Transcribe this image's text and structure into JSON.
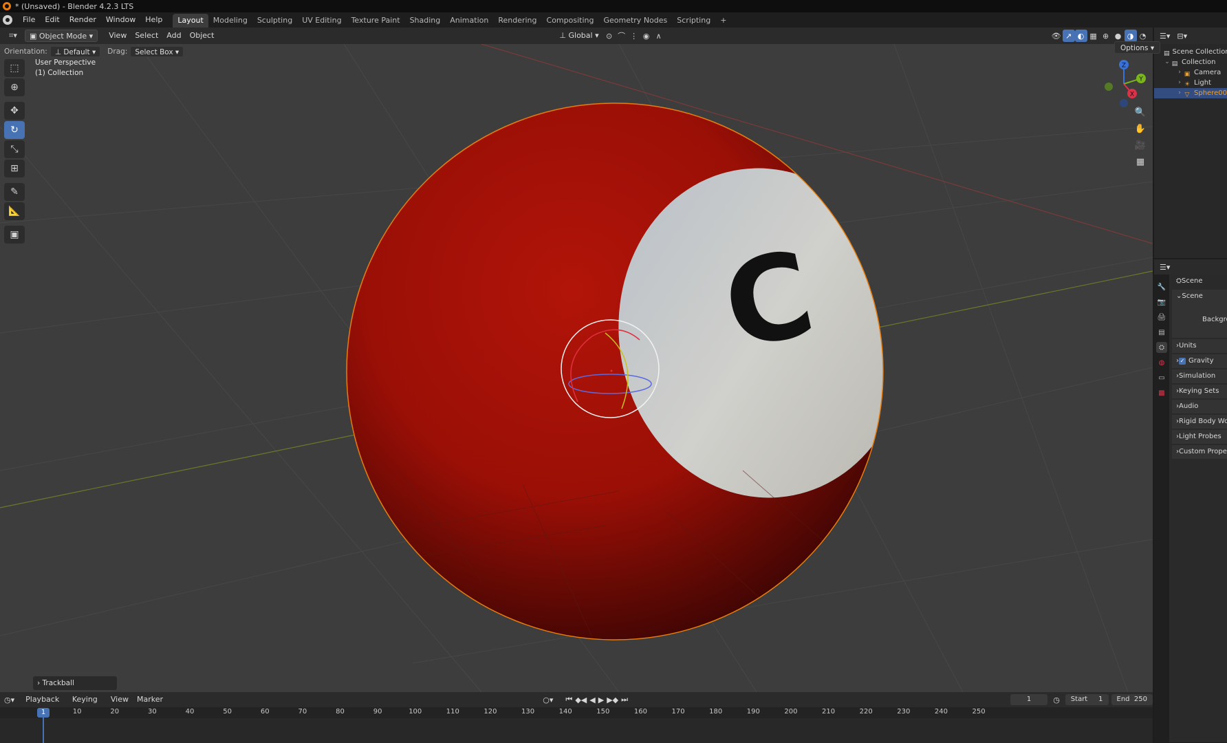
{
  "window": {
    "title": "* (Unsaved) - Blender 4.2.3 LTS"
  },
  "menus": [
    "File",
    "Edit",
    "Render",
    "Window",
    "Help"
  ],
  "workspaces": [
    "Layout",
    "Modeling",
    "Sculpting",
    "UV Editing",
    "Texture Paint",
    "Shading",
    "Animation",
    "Rendering",
    "Compositing",
    "Geometry Nodes",
    "Scripting"
  ],
  "active_workspace": "Layout",
  "add_workspace_icon": "+",
  "viewport_header": {
    "mode": "Object Mode",
    "menus": [
      "View",
      "Select",
      "Add",
      "Object"
    ],
    "transform_orientation": "Global"
  },
  "tool_settings": {
    "orientation_label": "Orientation:",
    "orientation_value": "Default",
    "drag_label": "Drag:",
    "drag_value": "Select Box",
    "options_label": "Options"
  },
  "viewport": {
    "perspective": "User Perspective",
    "collection": "(1) Collection",
    "ball_letter": "C",
    "colors": {
      "ball_red": "#b01208",
      "ball_white": "#d8d8d8",
      "background": "#3d3d3d",
      "selection_outline": "#e87d0d"
    }
  },
  "gizmo_axes": {
    "z": "Z",
    "y": "Y",
    "x": "X"
  },
  "operator_panel": {
    "label": "Trackball"
  },
  "outliner": {
    "root": "Scene Collection",
    "collection": "Collection",
    "items": [
      "Camera",
      "Light",
      "Sphere00"
    ]
  },
  "properties": {
    "header": "Scene",
    "panel_title": "Scene",
    "background_label": "Backgro",
    "sections": [
      "Units",
      "Gravity",
      "Simulation",
      "Keying Sets",
      "Audio",
      "Rigid Body Wor",
      "Light Probes",
      "Custom Proper"
    ]
  },
  "timeline": {
    "menus": [
      "Playback",
      "Keying",
      "View",
      "Marker"
    ],
    "current_frame": "1",
    "start_label": "Start",
    "start_value": "1",
    "end_label": "End",
    "end_value": "250",
    "ruler": [
      "1",
      "10",
      "20",
      "30",
      "40",
      "50",
      "60",
      "70",
      "80",
      "90",
      "100",
      "110",
      "120",
      "130",
      "140",
      "150",
      "160",
      "170",
      "180",
      "190",
      "200",
      "210",
      "220",
      "230",
      "240",
      "250"
    ]
  }
}
